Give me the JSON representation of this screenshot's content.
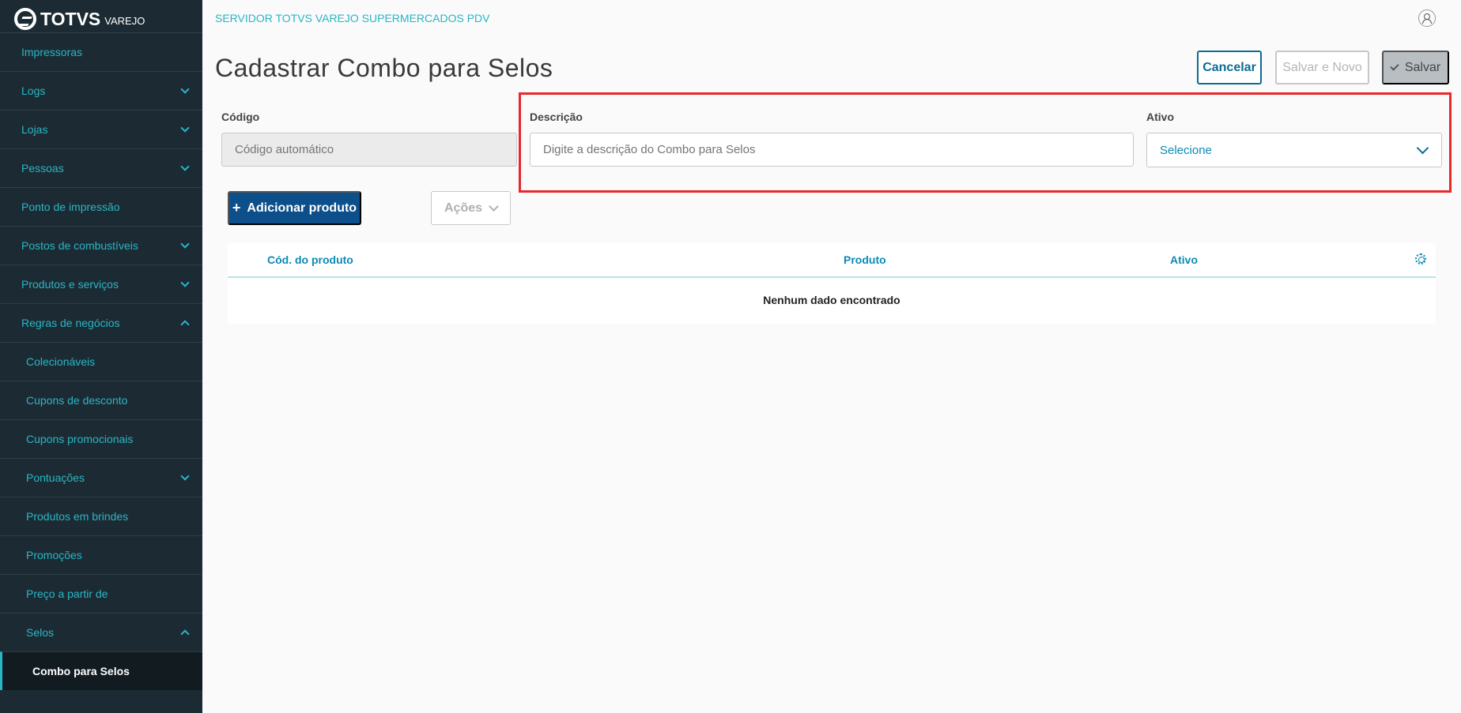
{
  "brand": {
    "name": "TOTVS",
    "sub": "VAREJO"
  },
  "sidebar": {
    "items": [
      {
        "label": "Impressoras",
        "chevron": ""
      },
      {
        "label": "Logs",
        "chevron": "down"
      },
      {
        "label": "Lojas",
        "chevron": "down"
      },
      {
        "label": "Pessoas",
        "chevron": "down"
      },
      {
        "label": "Ponto de impressão",
        "chevron": ""
      },
      {
        "label": "Postos de combustíveis",
        "chevron": "down"
      },
      {
        "label": "Produtos e serviços",
        "chevron": "down"
      },
      {
        "label": "Regras de negócios",
        "chevron": "up"
      },
      {
        "label": "Colecionáveis",
        "chevron": "",
        "sub": true
      },
      {
        "label": "Cupons de desconto",
        "chevron": "",
        "sub": true
      },
      {
        "label": "Cupons promocionais",
        "chevron": "",
        "sub": true
      },
      {
        "label": "Pontuações",
        "chevron": "down",
        "sub": true
      },
      {
        "label": "Produtos em brindes",
        "chevron": "",
        "sub": true
      },
      {
        "label": "Promoções",
        "chevron": "",
        "sub": true
      },
      {
        "label": "Preço a partir de",
        "chevron": "",
        "sub": true
      },
      {
        "label": "Selos",
        "chevron": "up",
        "sub": true
      },
      {
        "label": "Combo para Selos",
        "chevron": "",
        "active": true
      }
    ]
  },
  "header": {
    "server": "SERVIDOR TOTVS VAREJO SUPERMERCADOS PDV"
  },
  "page": {
    "title": "Cadastrar Combo para Selos"
  },
  "actions": {
    "cancel": "Cancelar",
    "save_new": "Salvar e Novo",
    "save": "Salvar"
  },
  "form": {
    "codigo": {
      "label": "Código",
      "placeholder": "Código automático"
    },
    "descricao": {
      "label": "Descrição",
      "placeholder": "Digite a descrição do Combo para Selos"
    },
    "ativo": {
      "label": "Ativo",
      "value": "Selecione"
    }
  },
  "toolbar": {
    "add_product": "Adicionar produto",
    "add_symbol": "+",
    "actions": "Ações"
  },
  "table": {
    "columns": [
      "Cód. do produto",
      "Produto",
      "Ativo"
    ],
    "empty": "Nenhum dado encontrado"
  }
}
